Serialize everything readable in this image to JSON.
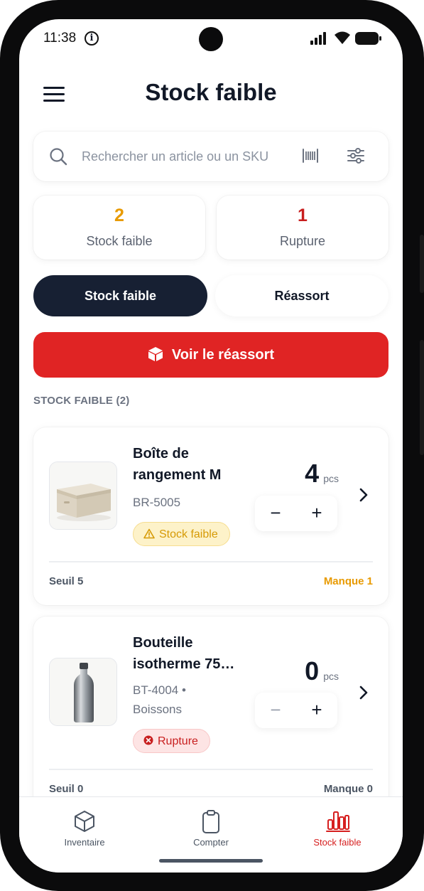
{
  "status_bar": {
    "time": "11:38",
    "info_glyph": "i"
  },
  "header": {
    "title": "Stock faible",
    "menu_icon": "menu-icon"
  },
  "search": {
    "placeholder": "Rechercher un article ou un SKU",
    "value": ""
  },
  "stats": [
    {
      "value": "2",
      "label": "Stock faible",
      "color": "#e89a00"
    },
    {
      "value": "1",
      "label": "Rupture",
      "color": "#c81e1e"
    }
  ],
  "tabs": [
    {
      "label": "Stock faible",
      "active": true
    },
    {
      "label": "Réassort",
      "active": false
    }
  ],
  "restock_button": {
    "label": "Voir le réassort",
    "icon": "box-icon"
  },
  "section": {
    "label": "STOCK FAIBLE (2)"
  },
  "items": [
    {
      "name": "Boîte de rangement M",
      "sku": "BR-5005",
      "quantity": "4",
      "unit": "pcs",
      "badge": "Stock faible",
      "threshold": "Seuil 5",
      "missing": "Manque 1",
      "missing_color": "#e89a00"
    },
    {
      "name": "Bouteille isotherme 75…",
      "sku": "BT-4004 •",
      "category": "Boissons",
      "quantity": "0",
      "unit": "pcs",
      "badge": "Rupture",
      "threshold": "Seuil 0",
      "missing": "Manque 0",
      "missing_color": "#4b5563"
    }
  ],
  "bottom_nav": [
    {
      "label": "Inventaire",
      "icon": "cube-icon",
      "active": false
    },
    {
      "label": "Compter",
      "icon": "clipboard-icon",
      "active": false
    },
    {
      "label": "Stock faible",
      "icon": "bar-chart-icon",
      "active": true
    }
  ],
  "colors": {
    "accent_red": "#e02424",
    "dark": "#172033",
    "warning": "#e89a00"
  }
}
